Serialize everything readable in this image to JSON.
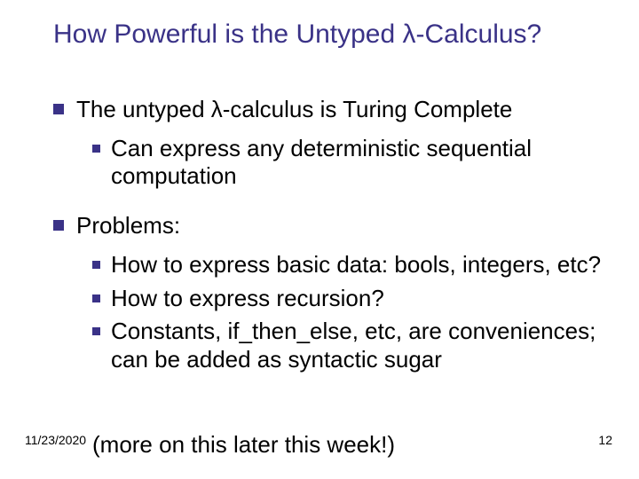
{
  "title": "How Powerful is the Untyped λ-Calculus?",
  "bullets": {
    "b1": "The untyped λ-calculus is Turing Complete",
    "b1_1": "Can express any deterministic sequential computation",
    "b2": "Problems:",
    "b2_1": "How to express basic data: bools, integers, etc?",
    "b2_2": "How to express recursion?",
    "b2_3": "Constants, if_then_else, etc, are conveniences; can be added as syntactic sugar"
  },
  "closing": "(more on this later this week!)",
  "footer": {
    "date": "11/23/2020",
    "page": "12"
  }
}
